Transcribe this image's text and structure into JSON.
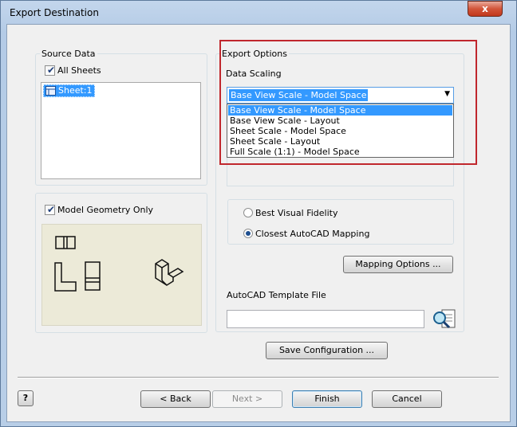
{
  "window": {
    "title": "Export Destination",
    "close_glyph": "x"
  },
  "source_data": {
    "label": "Source Data",
    "all_sheets_label": "All Sheets",
    "all_sheets_checked": true,
    "sheets": [
      "Sheet:1"
    ]
  },
  "model_geometry": {
    "label": "Model Geometry Only",
    "checked": true
  },
  "export_options": {
    "label": "Export Options",
    "data_scaling_label": "Data Scaling",
    "selected": "Base View Scale - Model Space",
    "options": [
      "Base View Scale - Model Space",
      "Base View Scale - Layout",
      "Sheet Scale - Model Space",
      "Sheet Scale - Layout",
      "Full Scale (1:1) - Model Space"
    ],
    "radio_best": "Best Visual Fidelity",
    "radio_closest": "Closest AutoCAD Mapping",
    "mapping_button": "Mapping Options ...",
    "template_label": "AutoCAD Template File",
    "template_value": ""
  },
  "buttons": {
    "save_config": "Save Configuration ...",
    "back": "< Back",
    "next": "Next >",
    "finish": "Finish",
    "cancel": "Cancel",
    "help": "?"
  },
  "icons": {
    "help": "help-icon",
    "browse": "browse-file-icon",
    "sheet": "sheet-icon",
    "dropdown": "chevron-down-icon"
  },
  "colors": {
    "selection": "#3399ff",
    "highlight_box": "#c0272d",
    "close_button": "#c1381c"
  }
}
